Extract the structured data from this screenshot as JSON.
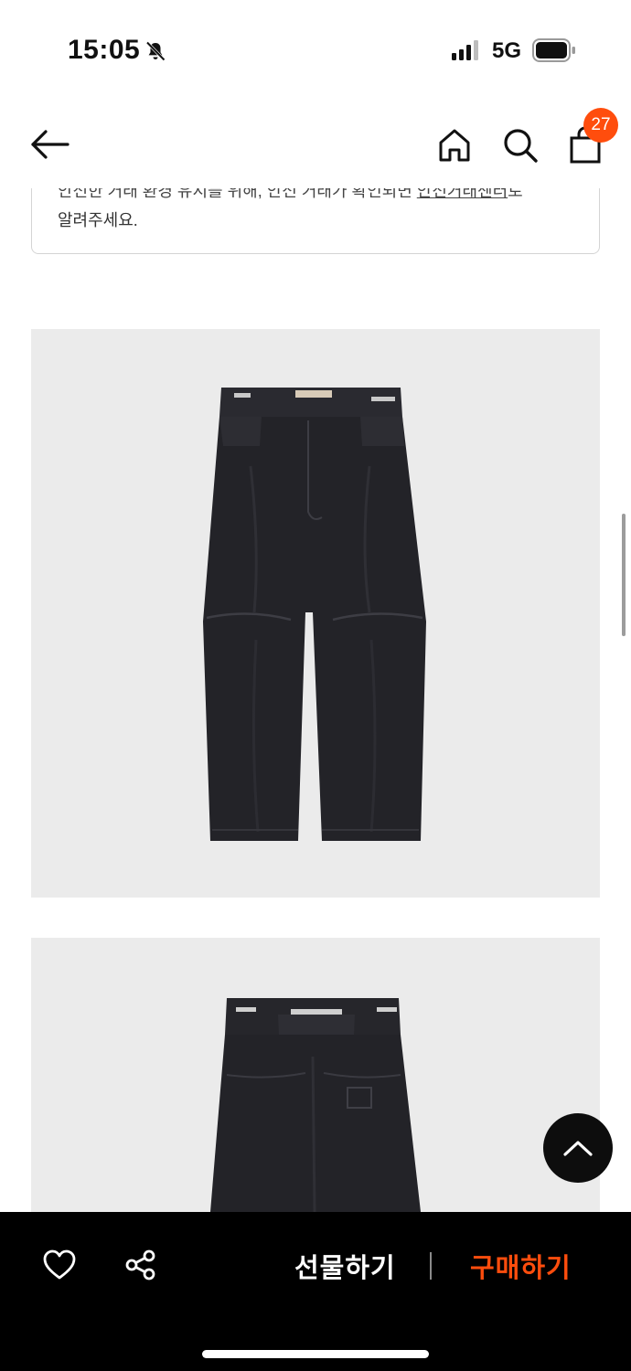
{
  "status_bar": {
    "time": "15:05",
    "network": "5G",
    "icons": [
      "bell-slash-icon",
      "signal-icon",
      "battery-icon"
    ]
  },
  "header": {
    "icons": [
      "back-arrow-icon",
      "home-icon",
      "search-icon",
      "shopping-bag-icon"
    ],
    "cart_count": "27"
  },
  "notice": {
    "line1_before_link": "안전한 거래 환경 유지를 위해, 안전 거래가 확인되면 ",
    "line1_link": "안전거래센터",
    "line1_after_link": "로",
    "line2": "알려주세요."
  },
  "product_images": [
    {
      "subject": "black denim pants front view"
    },
    {
      "subject": "black denim pants back view"
    }
  ],
  "bottom_bar": {
    "gift_label": "선물하기",
    "buy_label": "구매하기",
    "icons": [
      "heart-icon",
      "share-icon"
    ]
  },
  "colors": {
    "accent": "#ff4d0d",
    "bottom_bar_bg": "#000000",
    "photo_bg": "#ebebeb"
  }
}
